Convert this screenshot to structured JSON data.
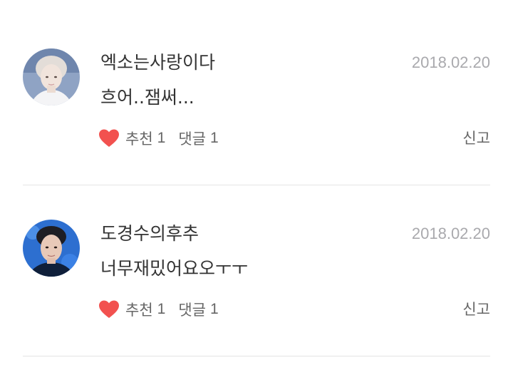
{
  "comments": [
    {
      "author": "엑소는사랑이다",
      "date": "2018.02.20",
      "text": "흐어..잼써...",
      "like_icon": "heart-icon",
      "recommend_label": "추천",
      "recommend_count": "1",
      "reply_label": "댓글",
      "reply_count": "1",
      "report_label": "신고"
    },
    {
      "author": "도경수의후추",
      "date": "2018.02.20",
      "text": "너무재밌어요오ㅜㅜ",
      "like_icon": "heart-icon",
      "recommend_label": "추천",
      "recommend_count": "1",
      "reply_label": "댓글",
      "reply_count": "1",
      "report_label": "신고"
    }
  ],
  "colors": {
    "heart": "#f2514f",
    "date": "#a9a9ad",
    "divider": "#e4e4e4",
    "text": "#333333",
    "secondary": "#666666"
  }
}
